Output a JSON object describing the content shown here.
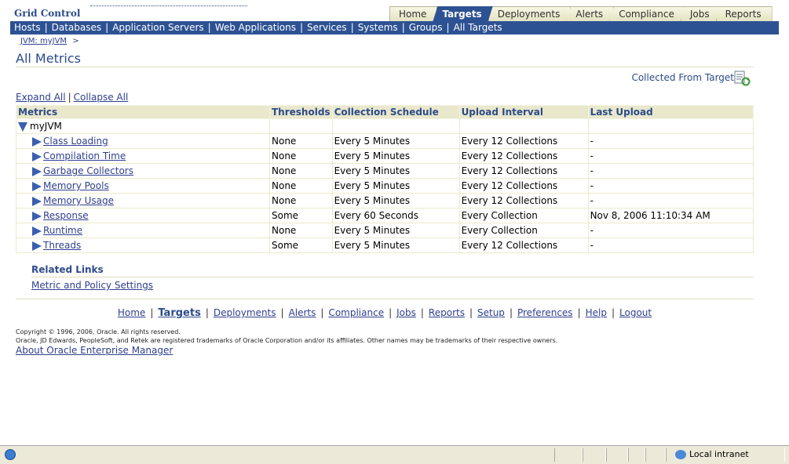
{
  "brand": "Grid Control",
  "tabs": [
    "Home",
    "Targets",
    "Deployments",
    "Alerts",
    "Compliance",
    "Jobs",
    "Reports"
  ],
  "active_tab": "Targets",
  "subnav": [
    "Hosts",
    "Databases",
    "Application Servers",
    "Web Applications",
    "Services",
    "Systems",
    "Groups",
    "All Targets"
  ],
  "breadcrumb": {
    "link": "JVM: myJVM",
    "sep": ">"
  },
  "page_title": "All Metrics",
  "collected_from": "Collected From Target",
  "expand_all": "Expand All",
  "collapse_all": "Collapse All",
  "table": {
    "headers": [
      "Metrics",
      "Thresholds",
      "Collection Schedule",
      "Upload Interval",
      "Last Upload"
    ],
    "group": "myJVM",
    "rows": [
      {
        "metric": "Class Loading",
        "thresholds": "None",
        "schedule": "Every 5 Minutes",
        "upload": "Every 12 Collections",
        "last": "-"
      },
      {
        "metric": "Compilation Time",
        "thresholds": "None",
        "schedule": "Every 5 Minutes",
        "upload": "Every 12 Collections",
        "last": "-"
      },
      {
        "metric": "Garbage Collectors",
        "thresholds": "None",
        "schedule": "Every 5 Minutes",
        "upload": "Every 12 Collections",
        "last": "-"
      },
      {
        "metric": "Memory Pools",
        "thresholds": "None",
        "schedule": "Every 5 Minutes",
        "upload": "Every 12 Collections",
        "last": "-"
      },
      {
        "metric": "Memory Usage",
        "thresholds": "None",
        "schedule": "Every 5 Minutes",
        "upload": "Every 12 Collections",
        "last": "-"
      },
      {
        "metric": "Response",
        "thresholds": "Some",
        "schedule": "Every 60 Seconds",
        "upload": "Every Collection",
        "last": "Nov 8, 2006 11:10:34 AM"
      },
      {
        "metric": "Runtime",
        "thresholds": "None",
        "schedule": "Every 5 Minutes",
        "upload": "Every Collection",
        "last": "-"
      },
      {
        "metric": "Threads",
        "thresholds": "Some",
        "schedule": "Every 5 Minutes",
        "upload": "Every 12 Collections",
        "last": "-"
      }
    ]
  },
  "related_links": {
    "title": "Related Links",
    "link": "Metric and Policy Settings"
  },
  "footer_nav": [
    "Home",
    "Targets",
    "Deployments",
    "Alerts",
    "Compliance",
    "Jobs",
    "Reports",
    "Setup",
    "Preferences",
    "Help",
    "Logout"
  ],
  "footer_current": "Targets",
  "copyright_line1": "Copyright © 1996, 2006, Oracle. All rights reserved.",
  "copyright_line2": "Oracle, JD Edwards, PeopleSoft, and Retek are registered trademarks of Oracle Corporation and/or its affiliates. Other names may be trademarks of their respective owners.",
  "about_link": "About Oracle Enterprise Manager",
  "statusbar": {
    "zone": "Local intranet"
  },
  "colors": {
    "accent": "#2d5293",
    "header_text": "#2d4b8a",
    "table_header_bg": "#e9e8cc"
  },
  "icons": {
    "collected": "refresh-document-icon",
    "expand": "triangle-right-icon",
    "collapse": "triangle-down-icon"
  }
}
